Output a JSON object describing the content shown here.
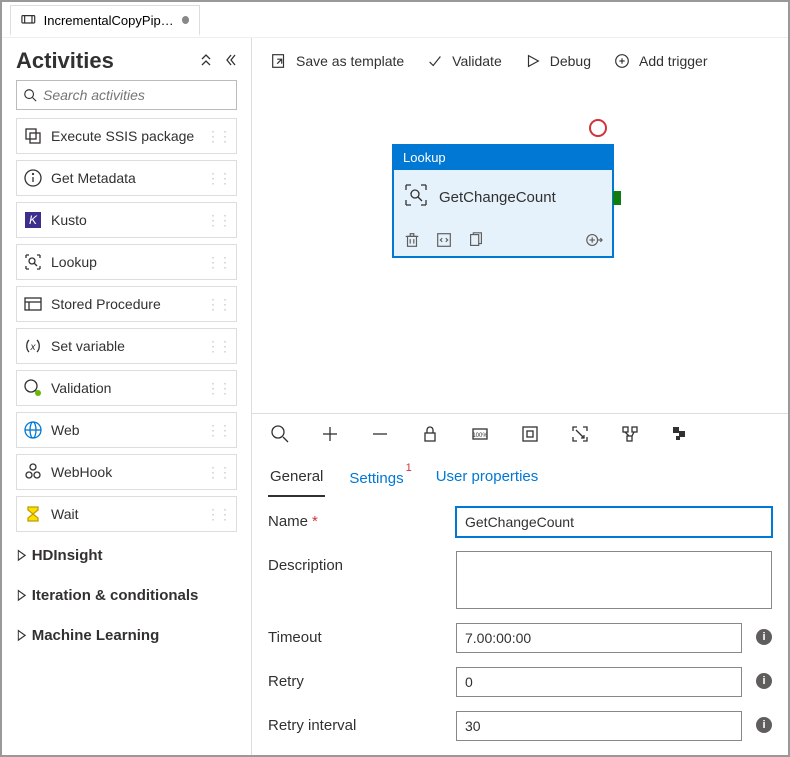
{
  "tab": {
    "icon": "pipeline-icon",
    "title": "IncrementalCopyPip…",
    "dirty": true
  },
  "sidebar": {
    "title": "Activities",
    "search_placeholder": "Search activities",
    "items": [
      {
        "icon": "ssis",
        "label": "Execute SSIS package"
      },
      {
        "icon": "info",
        "label": "Get Metadata"
      },
      {
        "icon": "kusto",
        "label": "Kusto"
      },
      {
        "icon": "lookup",
        "label": "Lookup"
      },
      {
        "icon": "sproc",
        "label": "Stored Procedure"
      },
      {
        "icon": "var",
        "label": "Set variable"
      },
      {
        "icon": "validation",
        "label": "Validation"
      },
      {
        "icon": "web",
        "label": "Web"
      },
      {
        "icon": "webhook",
        "label": "WebHook"
      },
      {
        "icon": "wait",
        "label": "Wait"
      }
    ],
    "groups": [
      "HDInsight",
      "Iteration & conditionals",
      "Machine Learning"
    ]
  },
  "toolbar": {
    "save_template": "Save as template",
    "validate": "Validate",
    "debug": "Debug",
    "add_trigger": "Add trigger"
  },
  "node": {
    "type_label": "Lookup",
    "name": "GetChangeCount"
  },
  "tabs": {
    "general": "General",
    "settings": "Settings",
    "settings_badge": "1",
    "user_props": "User properties"
  },
  "form": {
    "name_label": "Name",
    "name_value": "GetChangeCount",
    "desc_label": "Description",
    "desc_value": "",
    "timeout_label": "Timeout",
    "timeout_value": "7.00:00:00",
    "retry_label": "Retry",
    "retry_value": "0",
    "retry_interval_label": "Retry interval",
    "retry_interval_value": "30"
  }
}
